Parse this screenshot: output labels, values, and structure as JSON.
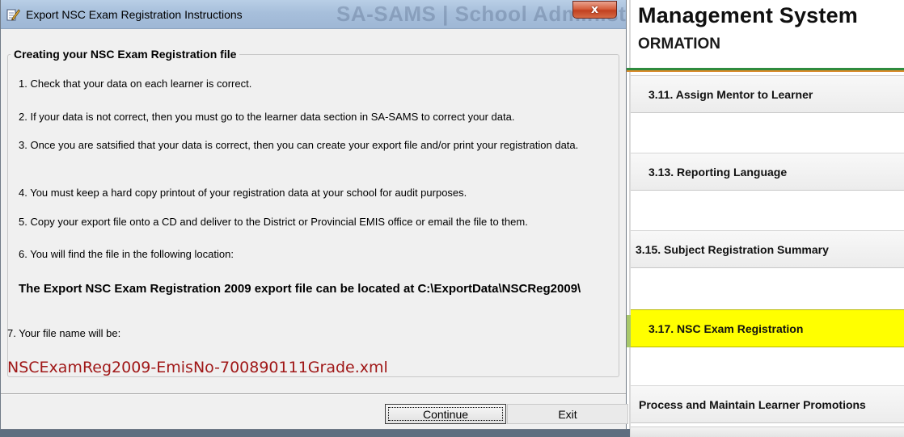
{
  "background": {
    "title": "Management System",
    "ghost_title": "SA-SAMS | School Administratio",
    "subtitle": "ORMATION",
    "menu": [
      {
        "label": "3.11.  Assign Mentor to Learner"
      },
      {
        "label": "3.13.  Reporting Language"
      },
      {
        "label": "3.15.  Subject Registration Summary"
      },
      {
        "label": "3.17.  NSC Exam Registration",
        "highlight": "#ffff00"
      },
      {
        "label": "Process and Maintain Learner Promotions"
      }
    ]
  },
  "dialog": {
    "title": "Export NSC Exam Registration Instructions",
    "close_symbol": "x",
    "group_label": "Creating your NSC Exam Registration file",
    "steps": [
      "1. Check that your data on each learner is correct.",
      "2. If your data is not correct, then you must go to the learner data section in SA-SAMS to correct your data.",
      "3. Once you are satsified that your data is correct, then you can create your export file and/or print your registration data.",
      "4. You must keep a hard copy printout of your registration data at your school for audit purposes.",
      "5. Copy your export file onto a CD and deliver to the District or Provincial EMIS office or email the file to them.",
      "6. You will find the file in the following location:"
    ],
    "location_text": "The Export NSC Exam Registration 2009 export file can be located at C:\\ExportData\\NSCReg2009\\",
    "filename_label": "7. Your file name will be:",
    "filename": "NSCExamReg2009-EmisNo-700890111Grade.xml",
    "buttons": {
      "continue": "Continue",
      "exit": "Exit"
    }
  },
  "colors": {
    "filename": "#a01818",
    "highlight": "#ffff00",
    "close_button": "#c2401f"
  },
  "icons": {
    "app": "notepad-pencil-icon",
    "close": "close-icon"
  }
}
